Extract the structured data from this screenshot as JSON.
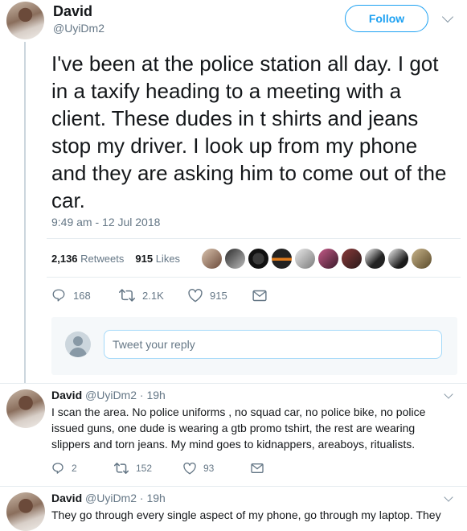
{
  "main_tweet": {
    "author_name": "David",
    "author_handle": "@UyiDm2",
    "follow_label": "Follow",
    "text": "I've been at the police station all day. I got in a taxify heading to a meeting with a client. These dudes in t shirts and jeans stop my driver. I look up from my phone and they are asking him to come out of the car.",
    "timestamp": "9:49 am - 12 Jul 2018",
    "retweets_count": "2,136",
    "retweets_label": "Retweets",
    "likes_count": "915",
    "likes_label": "Likes",
    "actions": {
      "replies": "168",
      "retweets": "2.1K",
      "likes": "915"
    }
  },
  "reply_box": {
    "placeholder": "Tweet your reply"
  },
  "thread": [
    {
      "author_name": "David",
      "author_handle": "@UyiDm2",
      "time": "· 19h",
      "text": "I scan the area. No police uniforms , no squad car, no police bike, no police issued guns, one dude is wearing a gtb promo tshirt, the rest are wearing slippers and torn jeans. My mind goes to kidnappers, areaboys, ritualists.",
      "actions": {
        "replies": "2",
        "retweets": "152",
        "likes": "93"
      }
    },
    {
      "author_name": "David",
      "author_handle": "@UyiDm2",
      "time": "· 19h",
      "text": "They go through every single aspect of my phone, go through my laptop.  They"
    }
  ],
  "colors": {
    "accent": "#1da1f2",
    "muted": "#657786",
    "text": "#14171a"
  }
}
